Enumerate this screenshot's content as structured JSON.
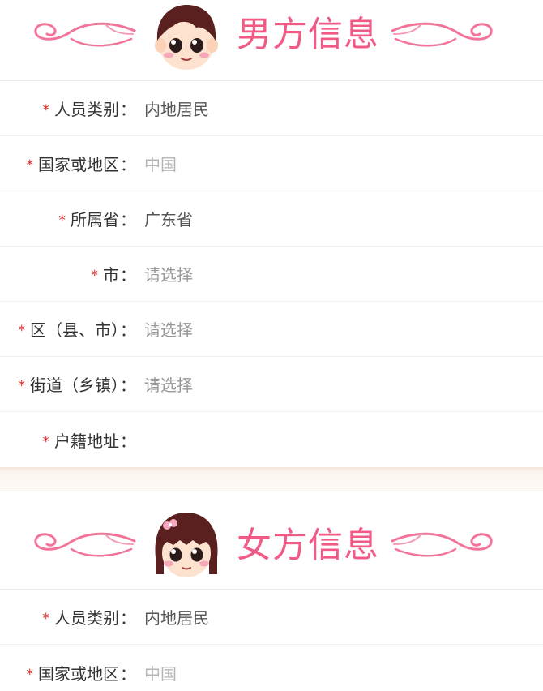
{
  "male": {
    "title": "男方信息",
    "fields": [
      {
        "label": "人员类别",
        "value": "内地居民",
        "style": "filled"
      },
      {
        "label": "国家或地区",
        "value": "中国",
        "style": "gray"
      },
      {
        "label": "所属省",
        "value": "广东省",
        "style": "filled"
      },
      {
        "label": "市",
        "value": "请选择",
        "style": "placeholder"
      },
      {
        "label": "区（县、市）",
        "value": "请选择",
        "style": "placeholder"
      },
      {
        "label": "街道（乡镇）",
        "value": "请选择",
        "style": "placeholder"
      },
      {
        "label": "户籍地址",
        "value": "",
        "style": "filled"
      }
    ]
  },
  "female": {
    "title": "女方信息",
    "fields": [
      {
        "label": "人员类别",
        "value": "内地居民",
        "style": "filled"
      },
      {
        "label": "国家或地区",
        "value": "中国",
        "style": "gray"
      }
    ]
  },
  "required_mark": "*",
  "colon": "：",
  "colors": {
    "accent": "#f05a84",
    "required": "#e02020"
  }
}
